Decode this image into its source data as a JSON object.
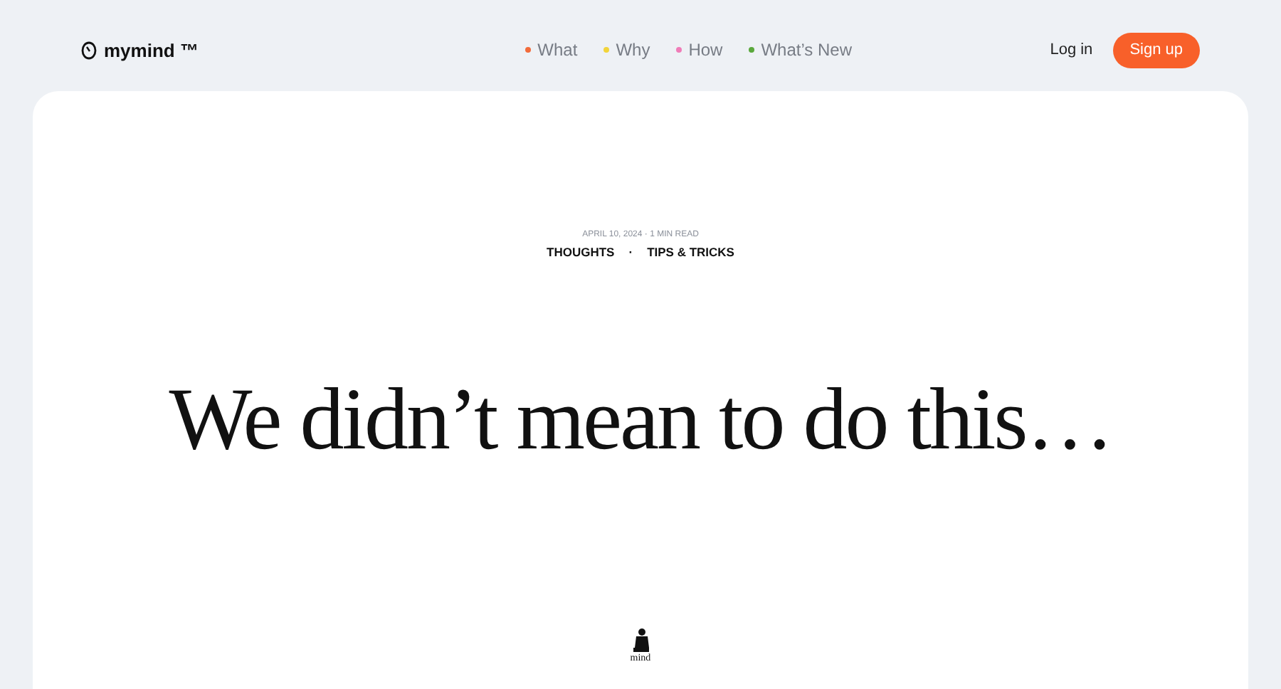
{
  "header": {
    "logo": "mymind ™",
    "nav": [
      {
        "label": "What",
        "color": "#f26b3a"
      },
      {
        "label": "Why",
        "color": "#f2d43a"
      },
      {
        "label": "How",
        "color": "#f07cb8"
      },
      {
        "label": "What’s New",
        "color": "#5aa83c"
      }
    ],
    "login": "Log in",
    "signup": "Sign up"
  },
  "article": {
    "meta": "APRIL 10, 2024 · 1 MIN READ",
    "tags": [
      "THOUGHTS",
      "TIPS & TRICKS"
    ],
    "separator": "·",
    "title": "We didn’t mean to do this…",
    "author_logo": "mind"
  }
}
